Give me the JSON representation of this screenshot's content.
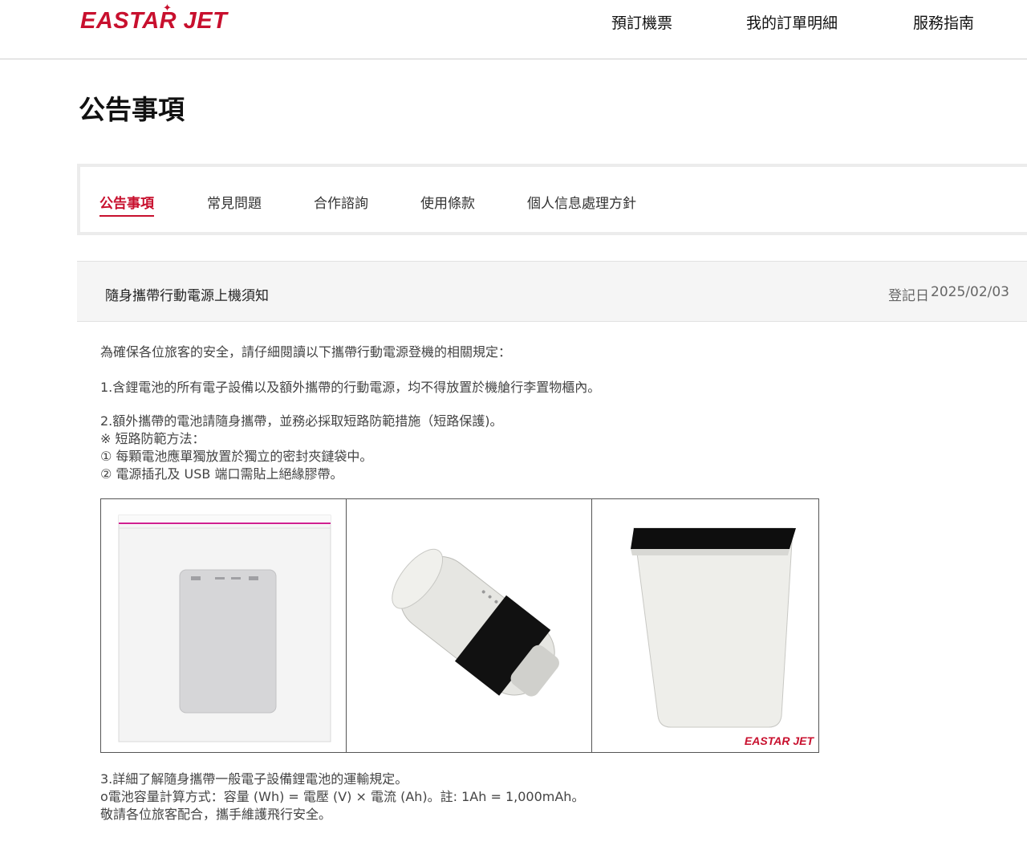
{
  "header": {
    "logo": "EASTAR JET",
    "nav": [
      "預訂機票",
      "我的訂單明細",
      "服務指南"
    ]
  },
  "page": {
    "title": "公告事項"
  },
  "tabs": [
    {
      "label": "公告事項",
      "active": true
    },
    {
      "label": "常見問題",
      "active": false
    },
    {
      "label": "合作諮詢",
      "active": false
    },
    {
      "label": "使用條款",
      "active": false
    },
    {
      "label": "個人信息處理方針",
      "active": false
    }
  ],
  "notice": {
    "title": "隨身攜帶行動電源上機須知",
    "date_label": "登記日",
    "date": "2025/02/03"
  },
  "content": {
    "intro": "為確保各位旅客的安全，請仔細閱讀以下攜帶行動電源登機的相關規定：",
    "rule1": "1.含鋰電池的所有電子設備以及額外攜帶的行動電源，均不得放置於機艙行李置物櫃內。",
    "rule2": "2.額外攜帶的電池請隨身攜帶，並務必採取短路防範措施（短路保護)。",
    "method_title": "※ 短路防範方法：",
    "method1": "① 每顆電池應單獨放置於獨立的密封夾鏈袋中。",
    "method2": "② 電源插孔及 USB 端口需貼上絕緣膠帶。",
    "rule3": "3.詳細了解隨身攜帶一般電子設備鋰電池的運輸規定。",
    "formula": "o電池容量計算方式：容量 (Wh) = 電壓 (V) × 電流 (Ah)。註: 1Ah = 1,000mAh。",
    "closing": "敬請各位旅客配合，攜手維護飛行安全。"
  },
  "images": {
    "watermark": "EASTAR JET",
    "items": [
      "power-bank-in-zip-bag",
      "power-bank-port-taped",
      "power-bank-end-taped"
    ]
  },
  "colors": {
    "brand": "#c8102e",
    "bar_bg": "#f5f5f5"
  }
}
